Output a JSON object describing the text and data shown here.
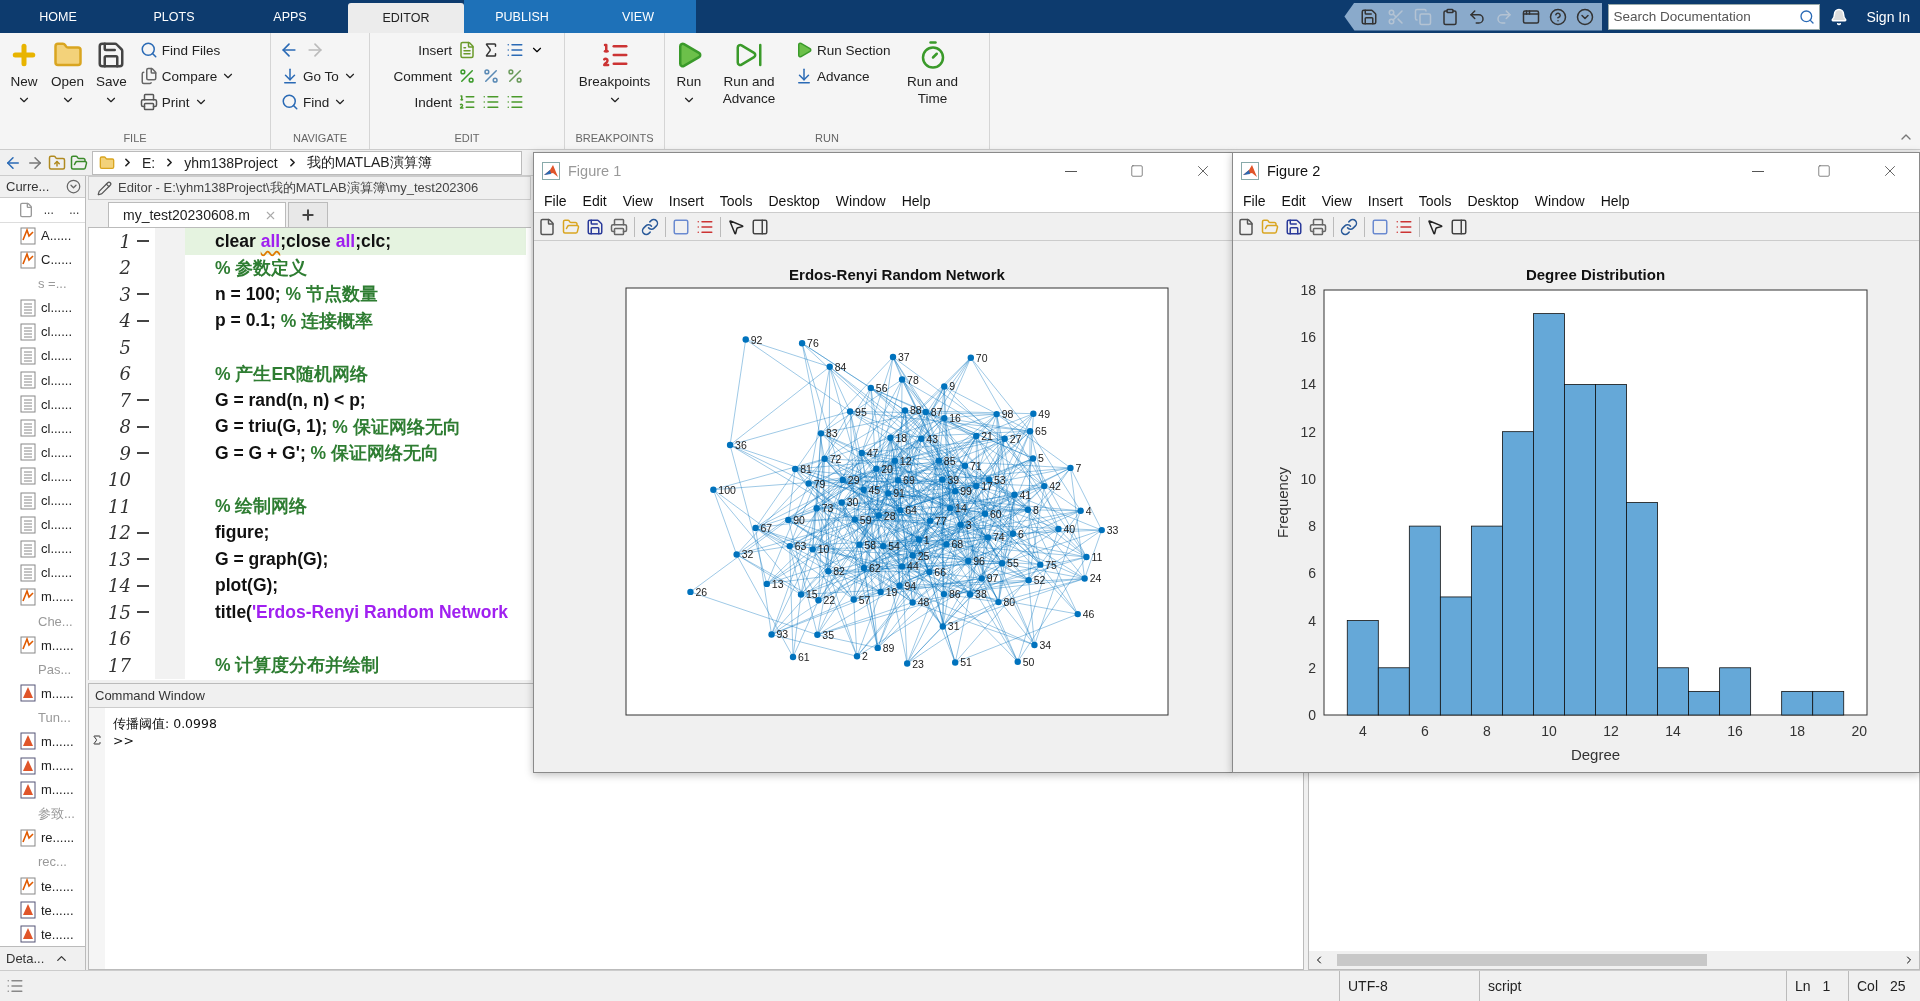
{
  "menu_bar": {
    "tabs": [
      {
        "label": "HOME",
        "selected": false,
        "kind": "main"
      },
      {
        "label": "PLOTS",
        "selected": false,
        "kind": "main"
      },
      {
        "label": "APPS",
        "selected": false,
        "kind": "main"
      },
      {
        "label": "EDITOR",
        "selected": true,
        "kind": "contextual"
      },
      {
        "label": "PUBLISH",
        "selected": false,
        "kind": "contextual"
      },
      {
        "label": "VIEW",
        "selected": false,
        "kind": "contextual"
      }
    ],
    "quick_access": [
      {
        "disabled": false
      },
      {
        "disabled": true
      },
      {
        "disabled": true
      },
      {
        "disabled": false
      },
      {
        "disabled": false
      },
      {
        "disabled": true
      },
      {
        "disabled": false
      },
      {
        "disabled": false
      },
      {
        "disabled": false
      }
    ],
    "search": {
      "placeholder": "Search Documentation"
    },
    "sign_in": "Sign In"
  },
  "ribbon": {
    "sections": [
      {
        "label": "FILE",
        "items": [
          {
            "kind": "large",
            "label": "New",
            "dropdown": true
          },
          {
            "kind": "large",
            "label": "Open",
            "dropdown": true
          },
          {
            "kind": "large",
            "label": "Save",
            "dropdown": true
          },
          {
            "kind": "small",
            "label": "Find Files",
            "dropdown": false
          },
          {
            "kind": "small",
            "label": "Compare",
            "dropdown": true
          },
          {
            "kind": "small",
            "label": "Print",
            "dropdown": true
          }
        ]
      },
      {
        "label": "NAVIGATE",
        "history": [
          {
            "disabled": false
          },
          {
            "disabled": true
          }
        ],
        "items": [
          {
            "kind": "small",
            "label": "Go To",
            "dropdown": true
          },
          {
            "kind": "small",
            "label": "Find",
            "dropdown": true
          }
        ]
      },
      {
        "label": "EDIT",
        "items": [
          {
            "kind": "row",
            "label": "Insert",
            "dropdown": true
          },
          {
            "kind": "row",
            "label": "Comment",
            "dropdown": false
          },
          {
            "kind": "row",
            "label": "Indent",
            "dropdown": false
          }
        ]
      },
      {
        "label": "BREAKPOINTS",
        "items": [
          {
            "kind": "large",
            "label": "Breakpoints",
            "dropdown": true
          }
        ]
      },
      {
        "label": "RUN",
        "items": [
          {
            "kind": "large",
            "label": "Run",
            "dropdown": true
          },
          {
            "kind": "large",
            "label": "Run and Advance",
            "dropdown": false
          },
          {
            "kind": "small",
            "label": "Run Section",
            "dropdown": false
          },
          {
            "kind": "small",
            "label": "Advance",
            "dropdown": false
          },
          {
            "kind": "large",
            "label": "Run and Time",
            "dropdown": false
          }
        ]
      }
    ]
  },
  "address_bar": {
    "path": [
      "E:",
      "yhm138Project",
      "我的MATLAB演算簿"
    ]
  },
  "current_folder": {
    "title": "Curre...",
    "columns": [
      "...",
      "..."
    ],
    "items": [
      {
        "kind": "function",
        "name": "A......"
      },
      {
        "kind": "function",
        "name": "C......"
      },
      {
        "kind": "note",
        "name": "s =..."
      },
      {
        "kind": "script",
        "name": "cl......"
      },
      {
        "kind": "script",
        "name": "cl......"
      },
      {
        "kind": "script",
        "name": "cl......"
      },
      {
        "kind": "script",
        "name": "cl......"
      },
      {
        "kind": "script",
        "name": "cl......"
      },
      {
        "kind": "script",
        "name": "cl......"
      },
      {
        "kind": "script",
        "name": "cl......"
      },
      {
        "kind": "script",
        "name": "cl......"
      },
      {
        "kind": "script",
        "name": "cl......"
      },
      {
        "kind": "script",
        "name": "cl......"
      },
      {
        "kind": "script",
        "name": "cl......"
      },
      {
        "kind": "script",
        "name": "cl......"
      },
      {
        "kind": "function",
        "name": "m......"
      },
      {
        "kind": "note",
        "name": "Che..."
      },
      {
        "kind": "function",
        "name": "m......"
      },
      {
        "kind": "note",
        "name": "Pas..."
      },
      {
        "kind": "live",
        "name": "m......"
      },
      {
        "kind": "note",
        "name": "Tun..."
      },
      {
        "kind": "live",
        "name": "m......"
      },
      {
        "kind": "live",
        "name": "m......"
      },
      {
        "kind": "live",
        "name": "m......"
      },
      {
        "kind": "note",
        "name": "参致..."
      },
      {
        "kind": "function",
        "name": "re......"
      },
      {
        "kind": "note",
        "name": "rec..."
      },
      {
        "kind": "function",
        "name": "te......"
      },
      {
        "kind": "live",
        "name": "te......"
      },
      {
        "kind": "live",
        "name": "te......"
      }
    ],
    "details": "Deta..."
  },
  "editor": {
    "title": "Editor - E:\\yhm138Project\\我的MATLAB演算簿\\my_test202306",
    "tabs": [
      {
        "label": "my_test20230608.m",
        "selected": true
      }
    ],
    "lines": [
      {
        "number": "1",
        "executable": true,
        "current": true,
        "segments": [
          {
            "kind": "code",
            "text": "clear "
          },
          {
            "kind": "string",
            "text": "all",
            "warning": true
          },
          {
            "kind": "code",
            "text": ";close "
          },
          {
            "kind": "string",
            "text": "all"
          },
          {
            "kind": "code",
            "text": ";clc;"
          }
        ]
      },
      {
        "number": "2",
        "executable": false,
        "current": false,
        "segments": [
          {
            "kind": "comment",
            "text": "% 参数定义"
          }
        ]
      },
      {
        "number": "3",
        "executable": true,
        "current": false,
        "segments": [
          {
            "kind": "code",
            "text": "n = 100; "
          },
          {
            "kind": "comment",
            "text": "% 节点数量"
          }
        ]
      },
      {
        "number": "4",
        "executable": true,
        "current": false,
        "segments": [
          {
            "kind": "code",
            "text": "p = 0.1; "
          },
          {
            "kind": "comment",
            "text": "% 连接概率"
          }
        ]
      },
      {
        "number": "5",
        "executable": false,
        "current": false
      },
      {
        "number": "6",
        "executable": false,
        "current": false,
        "segments": [
          {
            "kind": "comment",
            "text": "% 产生ER随机网络"
          }
        ]
      },
      {
        "number": "7",
        "executable": true,
        "current": false,
        "segments": [
          {
            "kind": "code",
            "text": "G = rand(n, n) < p;"
          }
        ]
      },
      {
        "number": "8",
        "executable": true,
        "current": false,
        "segments": [
          {
            "kind": "code",
            "text": "G = triu(G, 1); "
          },
          {
            "kind": "comment",
            "text": "% 保证网络无向"
          }
        ]
      },
      {
        "number": "9",
        "executable": true,
        "current": false,
        "segments": [
          {
            "kind": "code",
            "text": "G = G + G'; "
          },
          {
            "kind": "comment",
            "text": "% 保证网络无向"
          }
        ]
      },
      {
        "number": "10",
        "executable": false,
        "current": false
      },
      {
        "number": "11",
        "executable": false,
        "current": false,
        "segments": [
          {
            "kind": "comment",
            "text": "% 绘制网络"
          }
        ]
      },
      {
        "number": "12",
        "executable": true,
        "current": false,
        "segments": [
          {
            "kind": "code",
            "text": "figure;"
          }
        ]
      },
      {
        "number": "13",
        "executable": true,
        "current": false,
        "segments": [
          {
            "kind": "code",
            "text": "G = graph(G);"
          }
        ]
      },
      {
        "number": "14",
        "executable": true,
        "current": false,
        "segments": [
          {
            "kind": "code",
            "text": "plot(G);"
          }
        ]
      },
      {
        "number": "15",
        "executable": true,
        "current": false,
        "segments": [
          {
            "kind": "code",
            "text": "title("
          },
          {
            "kind": "string",
            "text": "'Erdos-Renyi Random Network"
          }
        ]
      },
      {
        "number": "16",
        "executable": false,
        "current": false
      },
      {
        "number": "17",
        "executable": false,
        "current": false,
        "segments": [
          {
            "kind": "comment",
            "text": "% 计算度分布并绘制"
          }
        ]
      }
    ]
  },
  "command_window": {
    "title": "Command Window",
    "output": [
      "传播阈值: 0.0998"
    ],
    "prompt": ">>"
  },
  "figures": [
    {
      "kind": "network",
      "title": "Figure 1",
      "active": false,
      "menus": [
        "File",
        "Edit",
        "View",
        "Insert",
        "Tools",
        "Desktop",
        "Window",
        "Help"
      ],
      "network": {
        "title": "Erdos-Renyi Random Network",
        "nodes": [
          "92",
          "76",
          "37",
          "70",
          "84",
          "56",
          "78",
          "9",
          "95",
          "88",
          "87",
          "16",
          "98",
          "49",
          "83",
          "18",
          "43",
          "21",
          "27",
          "65",
          "36",
          "72",
          "47",
          "12",
          "85",
          "71",
          "5",
          "81",
          "79",
          "29",
          "20",
          "69",
          "39",
          "17",
          "53",
          "42",
          "7",
          "100",
          "73",
          "30",
          "45",
          "91",
          "99",
          "14",
          "41",
          "8",
          "67",
          "90",
          "59",
          "28",
          "64",
          "77",
          "3",
          "60",
          "40",
          "4",
          "33",
          "63",
          "10",
          "58",
          "54",
          "1",
          "68",
          "74",
          "6",
          "32",
          "82",
          "62",
          "44",
          "25",
          "66",
          "96",
          "55",
          "75",
          "11",
          "26",
          "13",
          "15",
          "19",
          "94",
          "86",
          "38",
          "97",
          "52",
          "24",
          "22",
          "57",
          "48",
          "80",
          "46",
          "93",
          "35",
          "31",
          "61",
          "2",
          "89",
          "23",
          "51",
          "50",
          "34"
        ]
      }
    },
    {
      "kind": "histogram",
      "title": "Figure 2",
      "active": true,
      "menus": [
        "File",
        "Edit",
        "View",
        "Insert",
        "Tools",
        "Desktop",
        "Window",
        "Help"
      ],
      "chart_data": {
        "type": "bar",
        "title": "Degree Distribution",
        "xlabel": "Degree",
        "ylabel": "Frequency",
        "x": [
          4,
          5,
          6,
          7,
          8,
          9,
          10,
          11,
          12,
          13,
          14,
          15,
          16,
          17,
          18,
          19
        ],
        "values": [
          4,
          2,
          8,
          5,
          8,
          12,
          17,
          14,
          14,
          9,
          2,
          1,
          2,
          0,
          1,
          1
        ],
        "xlim": [
          2.75,
          20.25
        ],
        "ylim": [
          0,
          18
        ],
        "xticks": [
          4,
          6,
          8,
          10,
          12,
          14,
          16,
          18,
          20
        ],
        "yticks": [
          0,
          2,
          4,
          6,
          8,
          10,
          12,
          14,
          16,
          18
        ]
      }
    }
  ],
  "status_bar": {
    "encoding": "UTF-8",
    "type": "script",
    "line_label": "Ln",
    "line": "1",
    "col_label": "Col",
    "col": "25"
  }
}
